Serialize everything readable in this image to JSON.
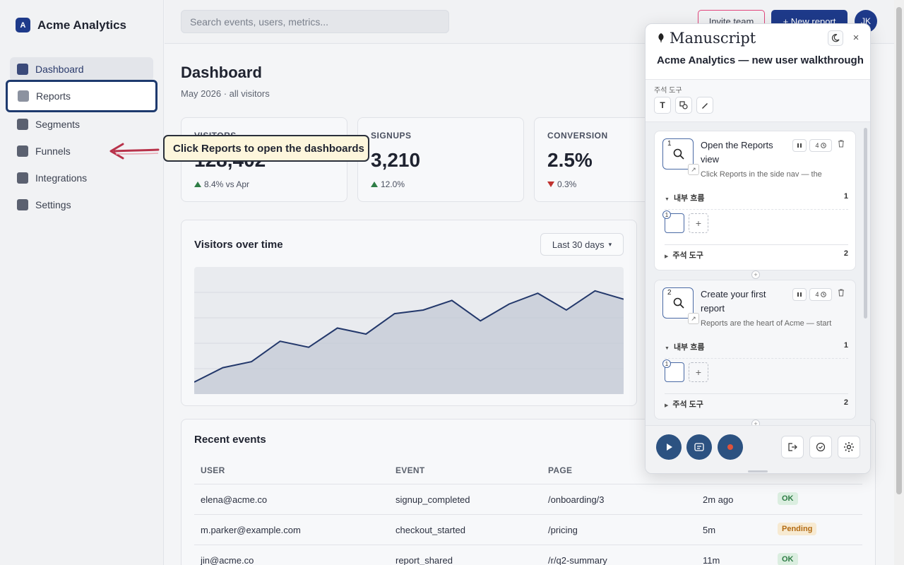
{
  "brand": {
    "logo_letter": "A",
    "name": "Acme Analytics"
  },
  "sidebar": {
    "items": [
      {
        "label": "Dashboard"
      },
      {
        "label": "Reports"
      },
      {
        "label": "Segments"
      },
      {
        "label": "Funnels"
      },
      {
        "label": "Integrations"
      },
      {
        "label": "Settings"
      }
    ]
  },
  "topbar": {
    "search_placeholder": "Search events, users, metrics...",
    "invite_label": "Invite team",
    "new_report_label": "+ New report",
    "avatar_initials": "JK"
  },
  "page": {
    "title": "Dashboard",
    "subtitle": "May 2026 · all visitors"
  },
  "kpis": [
    {
      "label": "VISITORS",
      "value": "128,402",
      "delta": "8.4% vs Apr",
      "direction": "up"
    },
    {
      "label": "SIGNUPS",
      "value": "3,210",
      "delta": "12.0%",
      "direction": "up"
    },
    {
      "label": "CONVERSION",
      "value": "2.5%",
      "delta": "0.3%",
      "direction": "down"
    }
  ],
  "visitors_chart": {
    "title": "Visitors over time",
    "range_label": "Last 30 days",
    "range_caret": "▾",
    "series": [
      0.1,
      0.22,
      0.27,
      0.44,
      0.39,
      0.55,
      0.5,
      0.67,
      0.7,
      0.78,
      0.61,
      0.75,
      0.84,
      0.7,
      0.86,
      0.79
    ]
  },
  "events": {
    "title": "Recent events",
    "columns": [
      "USER",
      "EVENT",
      "PAGE"
    ],
    "rows": [
      {
        "user": "elena@acme.co",
        "event": "signup_completed",
        "page": "/onboarding/3",
        "time": "2m ago",
        "status": "OK",
        "status_kind": "ok"
      },
      {
        "user": "m.parker@example.com",
        "event": "checkout_started",
        "page": "/pricing",
        "time": "5m",
        "status": "Pending",
        "status_kind": "pending"
      },
      {
        "user": "jin@acme.co",
        "event": "report_shared",
        "page": "/r/q2-summary",
        "time": "11m",
        "status": "OK",
        "status_kind": "ok"
      }
    ]
  },
  "callout": {
    "text": "Click Reports to open the dashboards"
  },
  "colors": {
    "accent": "#1e3a8a",
    "callout_bg": "#fdf6dc",
    "arrow": "#b8324a",
    "ok": "#2e7d45",
    "pending": "#b36b12",
    "down": "#c0322f"
  },
  "manuscript": {
    "logo": "Manuscript",
    "close": "×",
    "subtitle": "Acme Analytics — new user walkthrough",
    "tools_label": "주석 도구",
    "tool_text": "T",
    "steps": [
      {
        "number": "1",
        "title": "Open the Reports view",
        "description": "Click Reports in the side nav — the",
        "duration": "4",
        "inner_flow_label": "내부 흐름",
        "inner_flow_count": "1",
        "mini_number": "1",
        "annotations_label": "주석 도구",
        "annotations_count": "2"
      },
      {
        "number": "2",
        "title": "Create your first report",
        "description": "Reports are the heart of Acme — start",
        "duration": "4",
        "inner_flow_label": "내부 흐름",
        "inner_flow_count": "1",
        "mini_number": "1",
        "annotations_label": "주석 도구",
        "annotations_count": "2"
      }
    ]
  }
}
